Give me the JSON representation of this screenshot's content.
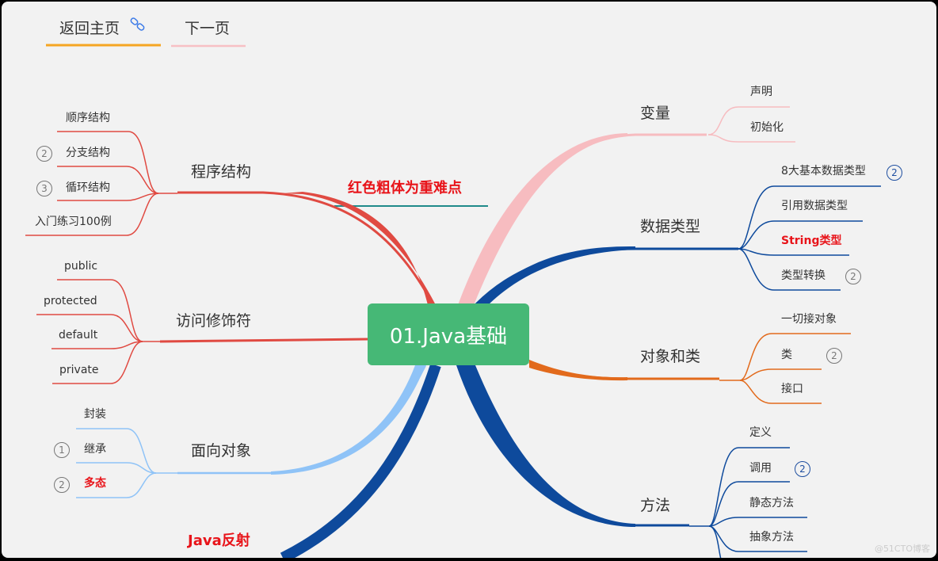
{
  "nav": {
    "home_label": "返回主页",
    "home_icon": "link-icon",
    "next_label": "下一页",
    "home_underline_color": "#f5a623",
    "next_underline_color": "#f7c0c4"
  },
  "center": {
    "label": "01.Java基础",
    "color": "#46b876"
  },
  "note": {
    "label": "红色粗体为重难点",
    "underline_color": "#1f8a8a"
  },
  "branches": {
    "program_structure": {
      "label": "程序结构",
      "color": "#e04a42",
      "children": [
        {
          "label": "顺序结构"
        },
        {
          "label": "分支结构",
          "badge": "2"
        },
        {
          "label": "循环结构",
          "badge": "3"
        },
        {
          "label": "入门练习100例"
        }
      ]
    },
    "access_modifiers": {
      "label": "访问修饰符",
      "color": "#e04a42",
      "children": [
        {
          "label": "public"
        },
        {
          "label": "protected"
        },
        {
          "label": "default"
        },
        {
          "label": "private"
        }
      ]
    },
    "oop": {
      "label": "面向对象",
      "color": "#8fc3f7",
      "children": [
        {
          "label": "封装"
        },
        {
          "label": "继承",
          "badge": "1"
        },
        {
          "label": "多态",
          "badge": "2",
          "emphasis": true
        }
      ]
    },
    "reflection": {
      "label": "Java反射",
      "color": "#0e4a9c",
      "emphasis": true
    },
    "variables": {
      "label": "变量",
      "color": "#f7bcc0",
      "children": [
        {
          "label": "声明"
        },
        {
          "label": "初始化"
        }
      ]
    },
    "data_types": {
      "label": "数据类型",
      "color": "#0e4a9c",
      "children": [
        {
          "label": "8大基本数据类型",
          "badge": "2",
          "badge_color": "blue"
        },
        {
          "label": "引用数据类型"
        },
        {
          "label": "String类型",
          "emphasis": true
        },
        {
          "label": "类型转换",
          "badge": "2"
        }
      ]
    },
    "objects_classes": {
      "label": "对象和类",
      "color": "#e26a1c",
      "children": [
        {
          "label": "一切接对象"
        },
        {
          "label": "类",
          "badge": "2"
        },
        {
          "label": "接口"
        }
      ]
    },
    "methods": {
      "label": "方法",
      "color": "#0e4a9c",
      "children": [
        {
          "label": "定义"
        },
        {
          "label": "调用",
          "badge": "2",
          "badge_color": "blue"
        },
        {
          "label": "静态方法"
        },
        {
          "label": "抽象方法"
        }
      ]
    }
  },
  "watermark": "@51CTO博客"
}
